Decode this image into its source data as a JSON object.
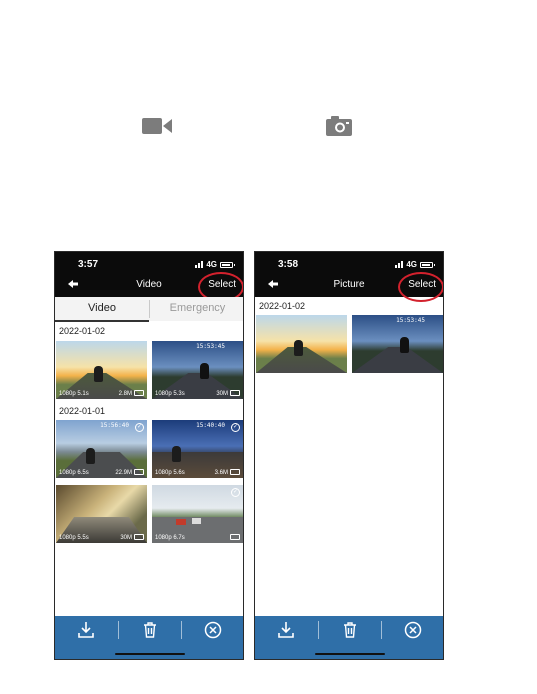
{
  "icons": {
    "video": "video-camera-icon",
    "photo": "photo-camera-icon"
  },
  "colors": {
    "accent_bar": "#2f6fa8",
    "highlight_ring": "#d3212d",
    "header": "#0b0b0b",
    "top_icons": "#7c7c7c"
  },
  "video_screen": {
    "status": {
      "time": "3:57",
      "network": "4G"
    },
    "title": "Video",
    "select_label": "Select",
    "tabs": [
      {
        "label": "Video",
        "active": true
      },
      {
        "label": "Emergency",
        "active": false
      }
    ],
    "groups": [
      {
        "date": "2022-01-02",
        "items": [
          {
            "timestamp": "",
            "meta": "1080p 5.1s",
            "size": "2.8M"
          },
          {
            "timestamp": "15:53:45",
            "meta": "1080p 5.3s",
            "size": "30M"
          }
        ]
      },
      {
        "date": "2022-01-01",
        "items": [
          {
            "timestamp": "15:56:40",
            "meta": "1080p 6.5s",
            "size": "22.9M"
          },
          {
            "timestamp": "15:40:40",
            "meta": "1080p 5.6s",
            "size": "3.6M"
          },
          {
            "timestamp": "",
            "meta": "1080p 5.5s",
            "size": "30M"
          },
          {
            "timestamp": "",
            "meta": "1080p 6.7s",
            "size": ""
          }
        ]
      }
    ]
  },
  "picture_screen": {
    "status": {
      "time": "3:58",
      "network": "4G"
    },
    "title": "Picture",
    "select_label": "Select",
    "groups": [
      {
        "date": "2022-01-02",
        "items": [
          {
            "timestamp": ""
          },
          {
            "timestamp": "15:53:45"
          }
        ]
      }
    ]
  },
  "bottom_bar": {
    "icons": [
      "download-icon",
      "trash-icon",
      "close-circle-icon"
    ]
  }
}
